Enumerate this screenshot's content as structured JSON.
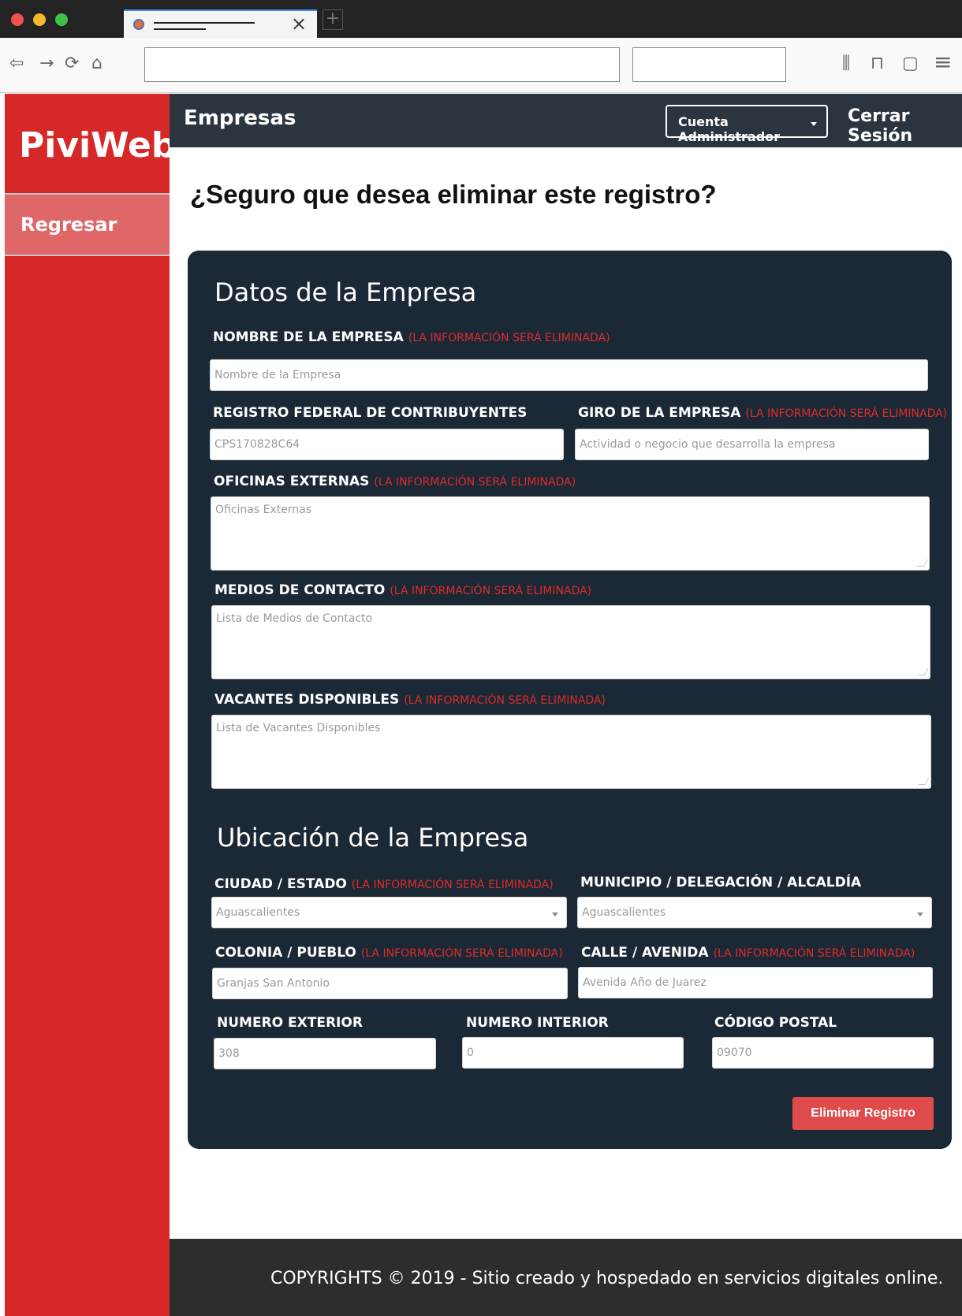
{
  "browser": {
    "tab_close": "×",
    "new_tab": "+",
    "nav_back": "⇦",
    "nav_forward": "→",
    "nav_reload": "⟳",
    "nav_home": "⌂",
    "toolbar_library": "⫼",
    "toolbar_reader": "⊓",
    "toolbar_container": "▢",
    "toolbar_menu": "≡"
  },
  "sidebar": {
    "brand": "PiviWeb",
    "links": [
      {
        "label": "Regresar"
      }
    ]
  },
  "header": {
    "title": "Empresas",
    "account_button": "Cuenta Administrador",
    "logout": "Cerrar Sesión"
  },
  "page": {
    "confirm_question": "¿Seguro que desea eliminar este registro?"
  },
  "form": {
    "warning": "(LA INFORMACIÓN SERÁ ELIMINADA)",
    "company_section_title": "Datos de la Empresa",
    "location_section_title": "Ubicación de la Empresa",
    "fields": {
      "nombre": {
        "label": "NOMBRE DE LA EMPRESA",
        "placeholder": "Nombre de la Empresa"
      },
      "rfc": {
        "label": "REGISTRO FEDERAL DE CONTRIBUYENTES",
        "value": "CPS170828C64"
      },
      "giro": {
        "label": "GIRO DE LA EMPRESA",
        "placeholder": "Actividad o negocio que desarrolla la empresa"
      },
      "oficinas": {
        "label": "OFICINAS EXTERNAS",
        "placeholder": "Oficinas Externas"
      },
      "medios": {
        "label": "MEDIOS DE CONTACTO",
        "placeholder": "Lista de Medios de Contacto"
      },
      "vacantes": {
        "label": "VACANTES DISPONIBLES",
        "placeholder": "Lista de Vacantes Disponibles"
      },
      "ciudad": {
        "label": "CIUDAD / ESTADO",
        "value": "Aguascalientes"
      },
      "municipio": {
        "label": "MUNICIPIO / DELEGACIÓN / ALCALDÍA",
        "value": "Aguascalientes"
      },
      "colonia": {
        "label": "COLONIA / PUEBLO",
        "value": "Granjas San Antonio"
      },
      "calle": {
        "label": "CALLE / AVENIDA",
        "value": "Avenida Año de Juarez"
      },
      "num_ext": {
        "label": "NUMERO EXTERIOR",
        "value": "308"
      },
      "num_int": {
        "label": "NUMERO INTERIOR",
        "value": "0"
      },
      "cp": {
        "label": "CÓDIGO POSTAL",
        "value": "09070"
      }
    },
    "delete_button": "Eliminar Registro"
  },
  "footer": {
    "text": "COPYRIGHTS © 2019 - Sitio creado y hospedado en servicios digitales online."
  },
  "colors": {
    "sidebar": "#d62828",
    "panel": "#1a2935",
    "header": "#2b3540",
    "warning": "#e02a2a",
    "delete_button": "#df4b4b"
  }
}
